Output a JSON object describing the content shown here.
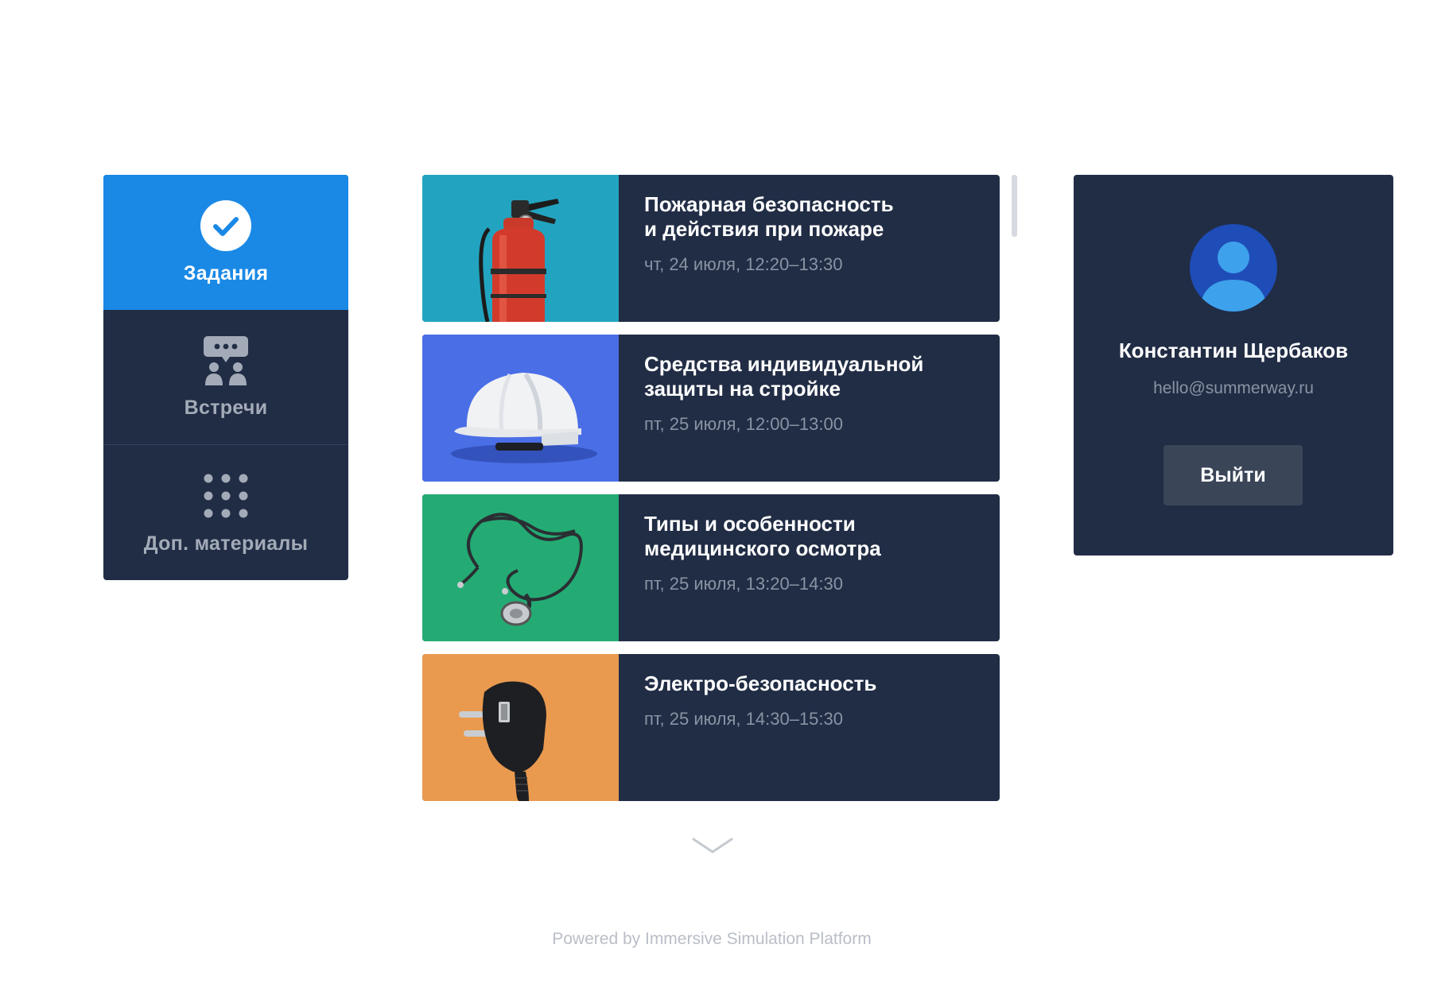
{
  "nav": {
    "items": [
      {
        "label": "Задания",
        "icon": "check-circle-icon",
        "active": true
      },
      {
        "label": "Встречи",
        "icon": "meeting-icon",
        "active": false
      },
      {
        "label": "Доп. материалы",
        "icon": "grid-dots-icon",
        "active": false
      }
    ]
  },
  "tasks": [
    {
      "title": "Пожарная безопасность\nи действия при пожаре",
      "time": "чт, 24 июля, 12:20–13:30",
      "image": "fire-extinguisher",
      "color": "#22a4c0"
    },
    {
      "title": "Средства индивидуальной\nзащиты на стройке",
      "time": "пт, 25 июля, 12:00–13:00",
      "image": "hard-hat",
      "color": "#4a6ee6"
    },
    {
      "title": "Типы и особенности\nмедицинского осмотра",
      "time": "пт, 25 июля, 13:20–14:30",
      "image": "stethoscope",
      "color": "#24ab74"
    },
    {
      "title": "Электро-безопасность",
      "time": "пт, 25 июля, 14:30–15:30",
      "image": "power-plug",
      "color": "#e99a4f"
    }
  ],
  "profile": {
    "name": "Константин Щербаков",
    "email": "hello@summerway.ru",
    "logout_label": "Выйти"
  },
  "footer": {
    "text": "Powered by Immersive Simulation Platform"
  },
  "colors": {
    "panel": "#212d45",
    "accent": "#1a89e6",
    "button": "#3a4558"
  }
}
